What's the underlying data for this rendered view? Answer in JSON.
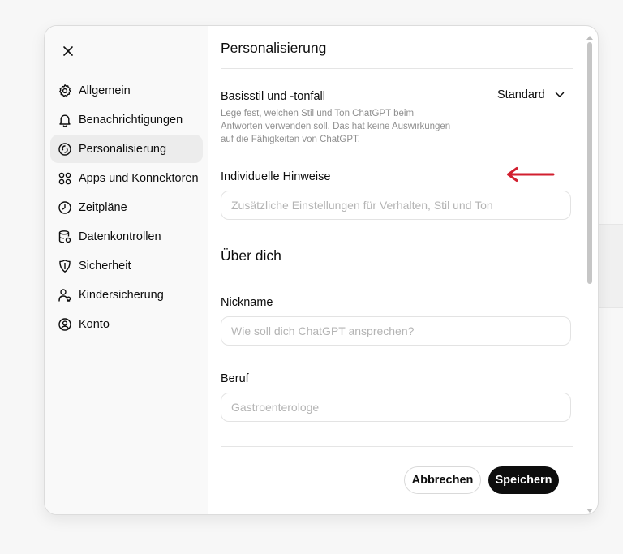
{
  "dialog": {
    "close_icon": "close-icon"
  },
  "sidebar": {
    "items": [
      {
        "label": "Allgemein",
        "icon": "gear-icon",
        "active": false
      },
      {
        "label": "Benachrichtigungen",
        "icon": "bell-icon",
        "active": false
      },
      {
        "label": "Personalisierung",
        "icon": "personalization-icon",
        "active": true
      },
      {
        "label": "Apps und Konnektoren",
        "icon": "apps-icon",
        "active": false
      },
      {
        "label": "Zeitpläne",
        "icon": "clock-icon",
        "active": false
      },
      {
        "label": "Datenkontrollen",
        "icon": "database-icon",
        "active": false
      },
      {
        "label": "Sicherheit",
        "icon": "shield-icon",
        "active": false
      },
      {
        "label": "Kindersicherung",
        "icon": "parental-icon",
        "active": false
      },
      {
        "label": "Konto",
        "icon": "account-icon",
        "active": false
      }
    ]
  },
  "main": {
    "title": "Personalisierung",
    "style": {
      "label": "Basisstil und -tonfall",
      "description": "Lege fest, welchen Stil und Ton ChatGPT beim Antworten verwenden soll. Das hat keine Auswirkungen auf die Fähigkeiten von ChatGPT.",
      "value": "Standard"
    },
    "custom_instructions": {
      "label": "Individuelle Hinweise",
      "placeholder": "Zusätzliche Einstellungen für Verhalten, Stil und Ton",
      "value": ""
    },
    "about": {
      "title": "Über dich",
      "nickname": {
        "label": "Nickname",
        "placeholder": "Wie soll dich ChatGPT ansprechen?",
        "value": ""
      },
      "occupation": {
        "label": "Beruf",
        "placeholder": "Gastroenterologe",
        "value": ""
      }
    },
    "buttons": {
      "cancel": "Abbrechen",
      "save": "Speichern"
    }
  },
  "colors": {
    "annotation_arrow": "#d21f2f",
    "active_nav_bg": "#ececec",
    "save_button_bg": "#0d0d0d"
  }
}
